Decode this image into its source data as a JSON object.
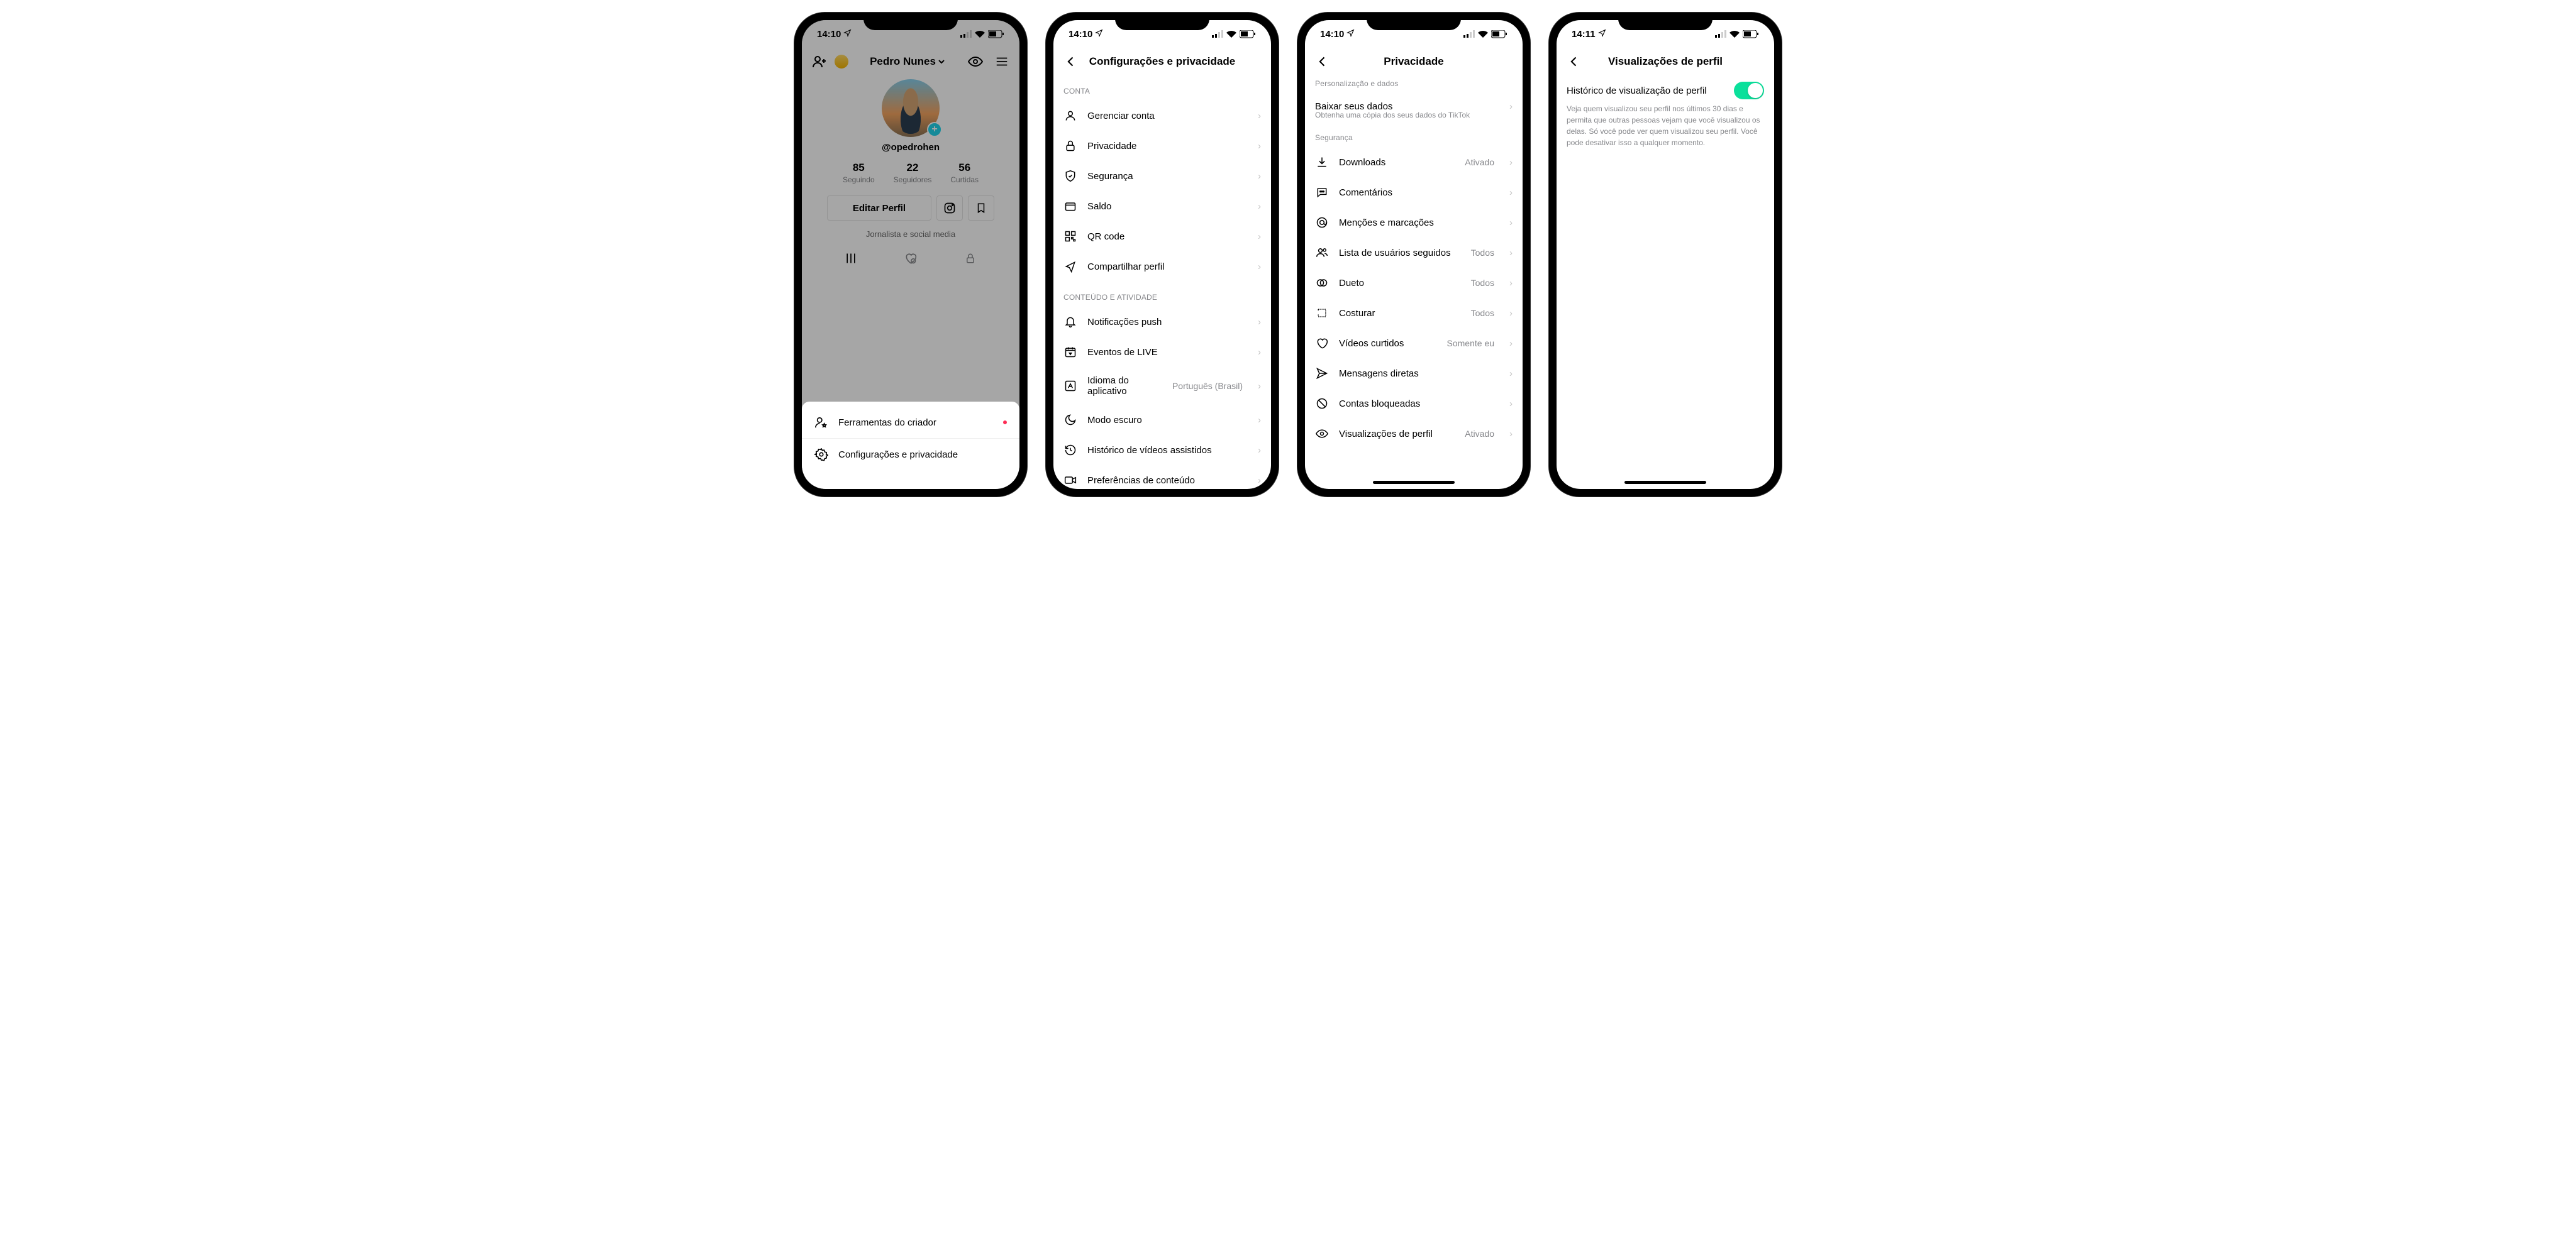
{
  "status": {
    "time1": "14:10",
    "time4": "14:11",
    "location_icon": "➤"
  },
  "screen1": {
    "top": {
      "name": "Pedro Nunes",
      "username": "@opedrohen"
    },
    "stats": {
      "following_num": "85",
      "following_label": "Seguindo",
      "followers_num": "22",
      "followers_label": "Seguidores",
      "likes_num": "56",
      "likes_label": "Curtidas"
    },
    "edit_btn": "Editar Perfil",
    "bio": "Jornalista e social media",
    "sheet": {
      "creator_tools": "Ferramentas do criador",
      "settings": "Configurações e privacidade"
    }
  },
  "screen2": {
    "title": "Configurações e privacidade",
    "sections": {
      "account": "CONTA",
      "content": "CONTEÚDO E ATIVIDADE"
    },
    "items": {
      "manage_account": "Gerenciar conta",
      "privacy": "Privacidade",
      "security": "Segurança",
      "balance": "Saldo",
      "qr": "QR code",
      "share": "Compartilhar perfil",
      "push": "Notificações push",
      "live_events": "Eventos de LIVE",
      "language": "Idioma do aplicativo",
      "language_value": "Português (Brasil)",
      "dark_mode": "Modo escuro",
      "history": "Histórico de vídeos assistidos",
      "content_pref": "Preferências de conteúdo"
    }
  },
  "screen3": {
    "title": "Privacidade",
    "sections": {
      "personalization": "Personalização e dados",
      "security": "Segurança"
    },
    "download_data": {
      "label": "Baixar seus dados",
      "sub": "Obtenha uma cópia dos seus dados do TikTok"
    },
    "items": {
      "downloads": "Downloads",
      "downloads_value": "Ativado",
      "comments": "Comentários",
      "mentions": "Menções e marcações",
      "followed_list": "Lista de usuários seguidos",
      "followed_list_value": "Todos",
      "duet": "Dueto",
      "duet_value": "Todos",
      "stitch": "Costurar",
      "stitch_value": "Todos",
      "liked_videos": "Vídeos curtidos",
      "liked_videos_value": "Somente eu",
      "dm": "Mensagens diretas",
      "blocked": "Contas bloqueadas",
      "profile_views": "Visualizações de perfil",
      "profile_views_value": "Ativado"
    }
  },
  "screen4": {
    "title": "Visualizações de perfil",
    "toggle_label": "Histórico de visualização de perfil",
    "description": "Veja quem visualizou seu perfil nos últimos 30 dias e permita que outras pessoas vejam que você visualizou os delas. Só você pode ver quem visualizou seu perfil. Você pode desativar isso a qualquer momento."
  }
}
